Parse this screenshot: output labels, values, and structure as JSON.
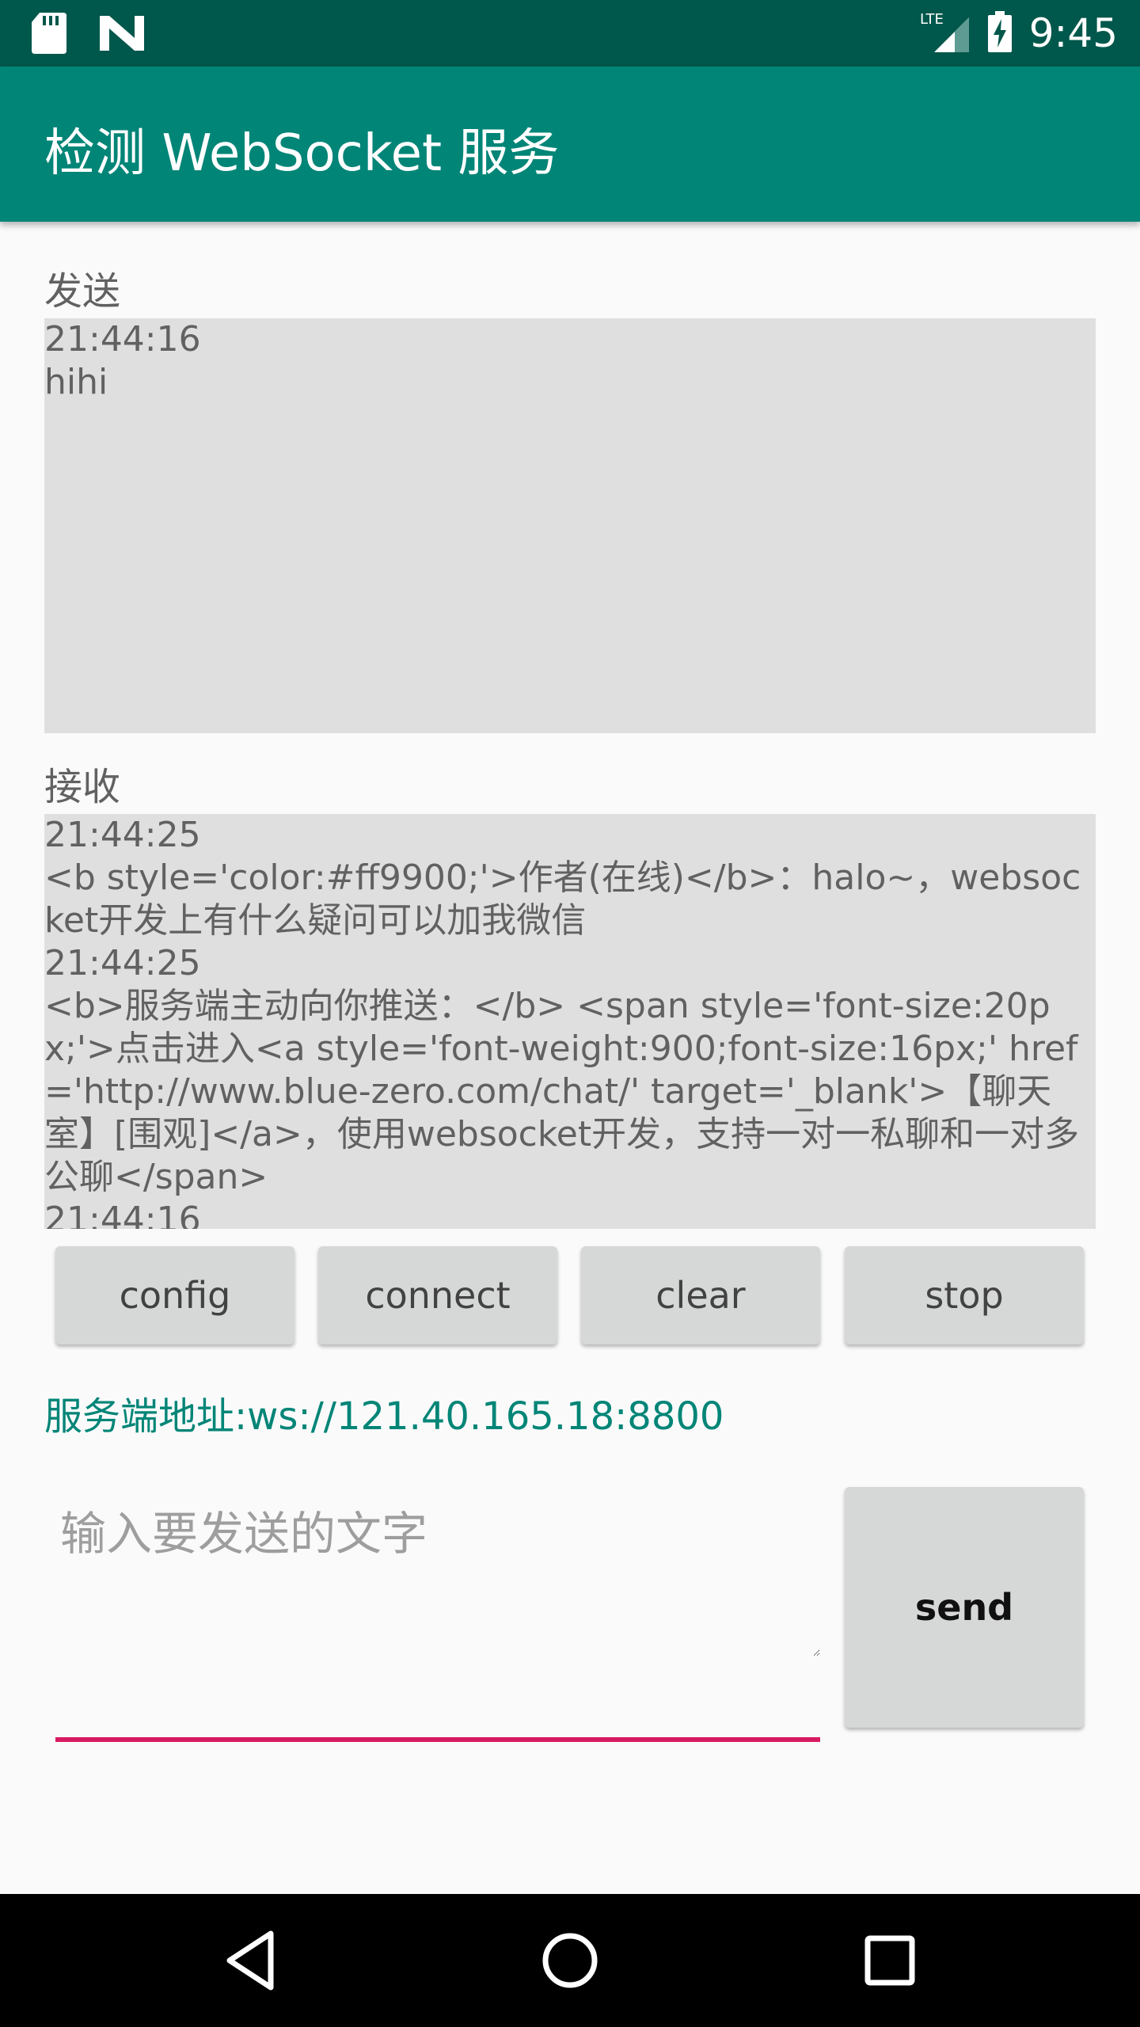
{
  "status_bar": {
    "time": "9:45",
    "network_label": "LTE",
    "left_icons": [
      "sd-card-icon",
      "n-logo-icon"
    ],
    "right_icons": [
      "lte-signal-icon",
      "battery-charging-icon"
    ]
  },
  "app_bar": {
    "title": "检测 WebSocket 服务"
  },
  "send_section": {
    "label": "发送",
    "log": [
      "21:44:16",
      "hihi"
    ]
  },
  "receive_section": {
    "label": "接收",
    "log": [
      "21:44:25",
      "<b style='color:#ff9900;'>作者(在线)</b>：halo~，websocket开发上有什么疑问可以加我微信",
      "21:44:25",
      "<b>服务端主动向你推送：</b> <span style='font-size:20px;'>点击进入<a style='font-weight:900;font-size:16px;' href='http://www.blue-zero.com/chat/' target='_blank'>【聊天室】[围观]</a>，使用websocket开发，支持一对一私聊和一对多公聊</span>",
      "21:44:16"
    ]
  },
  "buttons": {
    "config": "config",
    "connect": "connect",
    "clear": "clear",
    "stop": "stop",
    "send": "send"
  },
  "server": {
    "address": "服务端地址:ws://121.40.165.18:8800"
  },
  "input": {
    "placeholder": "输入要发送的文字",
    "value": ""
  },
  "nav_bar": {
    "icons": [
      "back-icon",
      "home-icon",
      "recents-icon"
    ]
  },
  "colors": {
    "status_bar": "#00574b",
    "app_bar": "#008577",
    "accent": "#d81b60",
    "log_background": "#e0dfdf",
    "button": "#d6d7d7"
  }
}
